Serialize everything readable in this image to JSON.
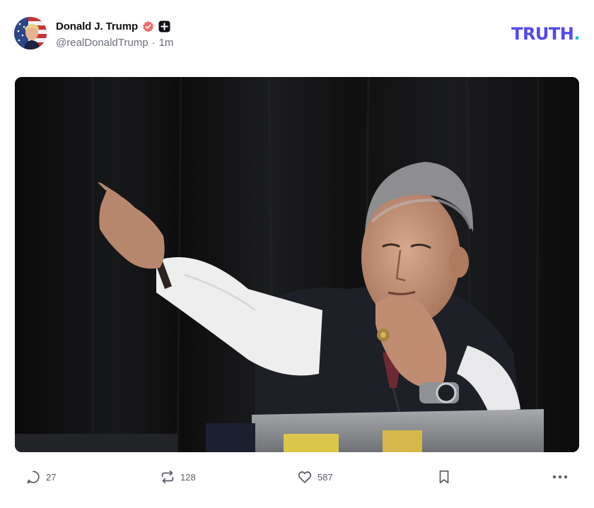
{
  "post": {
    "author": {
      "display_name": "Donald J. Trump",
      "handle": "@realDonaldTrump",
      "time_ago": "1m",
      "separator": "·",
      "avatar_icon": "avatar-flag-portrait",
      "verified_badge_icon": "verified-badge-icon",
      "plus_badge_icon": "plus-badge-icon"
    },
    "brand": {
      "text": "TRUTH",
      "dot": ".",
      "color": "#5448ee",
      "dot_color": "#12c9c9"
    },
    "media": {
      "kind": "photo",
      "alt_icon": "photo-man-pointing"
    },
    "actions": {
      "reply": {
        "icon": "reply-icon",
        "count": "27"
      },
      "retruth": {
        "icon": "retruth-icon",
        "count": "128"
      },
      "like": {
        "icon": "heart-icon",
        "count": "587"
      },
      "bookmark": {
        "icon": "bookmark-icon"
      },
      "more": {
        "icon": "more-icon"
      }
    }
  }
}
